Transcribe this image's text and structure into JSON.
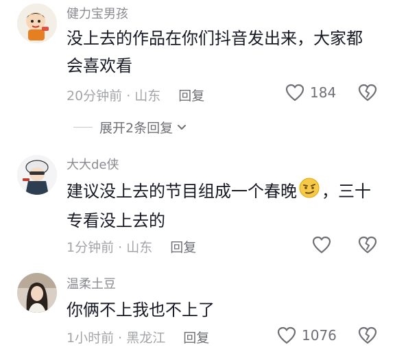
{
  "comments": [
    {
      "username": "健力宝男孩",
      "text": "没上去的作品在你们抖音发出来，大家都会喜欢看",
      "time_location": "20分钟前 · 山东",
      "reply_label": "回复",
      "like_count": "184",
      "expand_label": "展开2条回复",
      "avatar_icon": "cartoon-boy-avatar"
    },
    {
      "username": "大大de侠",
      "text_before_emoji": "建议没上去的节目组成一个春晚",
      "text_after_emoji": "，三十专看没上去的",
      "emoji_icon": "smirk-emoji-icon",
      "time_location": "1分钟前 · 山东",
      "reply_label": "回复",
      "like_count": "",
      "avatar_icon": "anime-character-avatar"
    },
    {
      "username": "温柔土豆",
      "text": "你俩不上我也不上了",
      "time_location": "1小时前 · 黑龙江",
      "reply_label": "回复",
      "like_count": "1076",
      "avatar_icon": "girl-photo-avatar"
    }
  ],
  "colors": {
    "username": "#8a8b91",
    "content": "#161823",
    "meta": "#a3a4a8",
    "icon": "#6e6f75"
  }
}
